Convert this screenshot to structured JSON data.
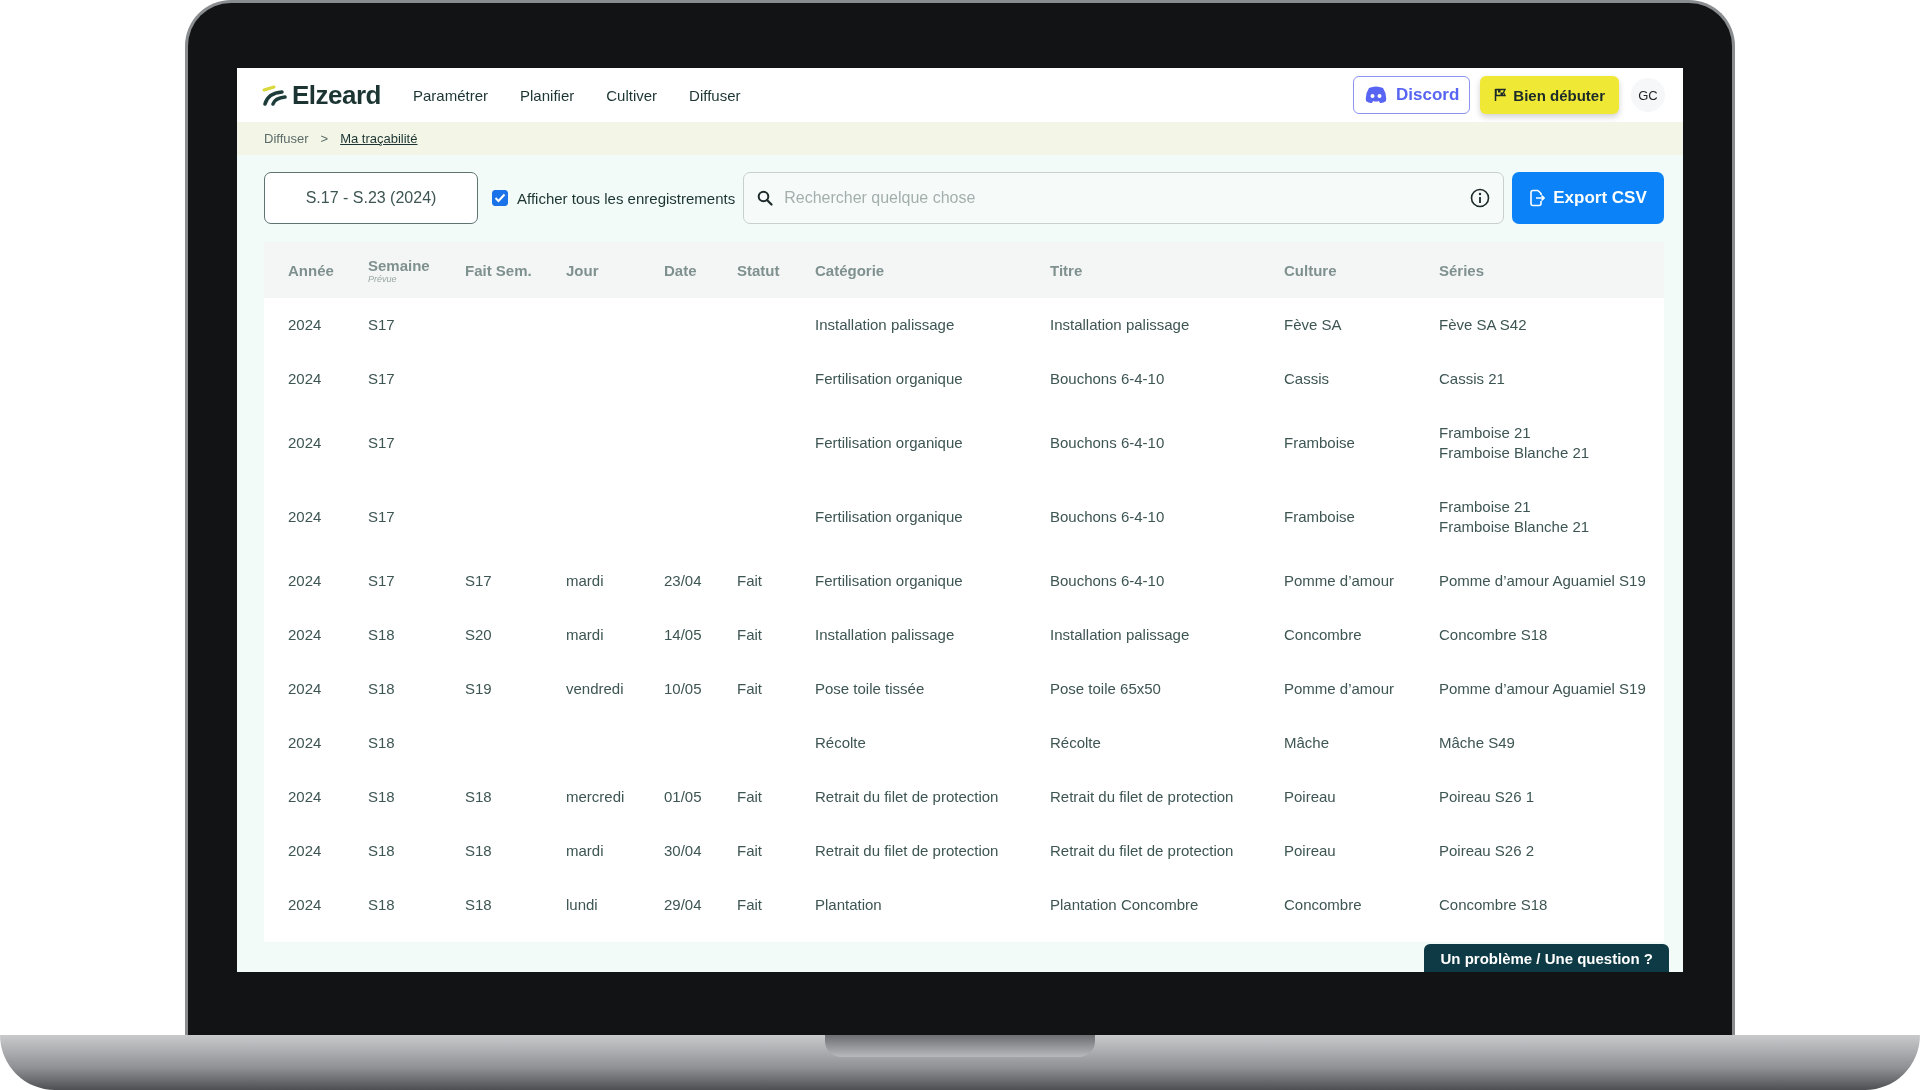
{
  "header": {
    "logo": "Elzeard",
    "nav": [
      {
        "label": "Paramétrer"
      },
      {
        "label": "Planifier"
      },
      {
        "label": "Cultiver"
      },
      {
        "label": "Diffuser"
      }
    ],
    "discord": "Discord",
    "start": "Bien débuter",
    "avatar": "GC"
  },
  "breadcrumb": [
    {
      "label": "Diffuser",
      "link": false
    },
    {
      "label": ">",
      "link": false
    },
    {
      "label": "Ma traçabilité",
      "link": true
    }
  ],
  "toolbar": {
    "period": "S.17 - S.23 (2024)",
    "show_all": {
      "label": "Afficher tous les enregistrements",
      "checked": true
    },
    "search": {
      "placeholder": "Rechercher quelque chose"
    },
    "export": "Export CSV"
  },
  "table": {
    "columns": [
      {
        "label": "Année"
      },
      {
        "label": "Semaine",
        "sub": "Prévue"
      },
      {
        "label": "Fait Sem."
      },
      {
        "label": "Jour"
      },
      {
        "label": "Date"
      },
      {
        "label": "Statut"
      },
      {
        "label": "Catégorie"
      },
      {
        "label": "Titre"
      },
      {
        "label": "Culture"
      },
      {
        "label": "Séries"
      }
    ],
    "rows": [
      {
        "cells": [
          "2024",
          "S17",
          "",
          "",
          "",
          "",
          "Installation palissage",
          "Installation palissage",
          "Fève SA"
        ],
        "series": [
          "Fève SA S42"
        ]
      },
      {
        "cells": [
          "2024",
          "S17",
          "",
          "",
          "",
          "",
          "Fertilisation organique",
          "Bouchons 6-4-10",
          "Cassis"
        ],
        "series": [
          "Cassis 21"
        ]
      },
      {
        "cells": [
          "2024",
          "S17",
          "",
          "",
          "",
          "",
          "Fertilisation organique",
          "Bouchons 6-4-10",
          "Framboise"
        ],
        "series": [
          "Framboise 21",
          "Framboise Blanche 21"
        ]
      },
      {
        "cells": [
          "2024",
          "S17",
          "",
          "",
          "",
          "",
          "Fertilisation organique",
          "Bouchons 6-4-10",
          "Framboise"
        ],
        "series": [
          "Framboise 21",
          "Framboise Blanche 21"
        ]
      },
      {
        "cells": [
          "2024",
          "S17",
          "S17",
          "mardi",
          "23/04",
          "Fait",
          "Fertilisation organique",
          "Bouchons 6-4-10",
          "Pomme d’amour"
        ],
        "series": [
          "Pomme d’amour Aguamiel S19"
        ]
      },
      {
        "cells": [
          "2024",
          "S18",
          "S20",
          "mardi",
          "14/05",
          "Fait",
          "Installation palissage",
          "Installation palissage",
          "Concombre"
        ],
        "series": [
          "Concombre S18"
        ]
      },
      {
        "cells": [
          "2024",
          "S18",
          "S19",
          "vendredi",
          "10/05",
          "Fait",
          "Pose toile tissée",
          "Pose toile 65x50",
          "Pomme d’amour"
        ],
        "series": [
          "Pomme d’amour Aguamiel S19"
        ]
      },
      {
        "cells": [
          "2024",
          "S18",
          "",
          "",
          "",
          "",
          "Récolte",
          "Récolte",
          "Mâche"
        ],
        "series": [
          "Mâche S49"
        ]
      },
      {
        "cells": [
          "2024",
          "S18",
          "S18",
          "mercredi",
          "01/05",
          "Fait",
          "Retrait du filet de protection",
          "Retrait du filet de protection",
          "Poireau"
        ],
        "series": [
          "Poireau S26 1"
        ]
      },
      {
        "cells": [
          "2024",
          "S18",
          "S18",
          "mardi",
          "30/04",
          "Fait",
          "Retrait du filet de protection",
          "Retrait du filet de protection",
          "Poireau"
        ],
        "series": [
          "Poireau S26 2"
        ]
      },
      {
        "cells": [
          "2024",
          "S18",
          "S18",
          "lundi",
          "29/04",
          "Fait",
          "Plantation",
          "Plantation Concombre",
          "Concombre"
        ],
        "series": [
          "Concombre S18"
        ]
      }
    ]
  },
  "help_button": "Un problème / Une question ?"
}
